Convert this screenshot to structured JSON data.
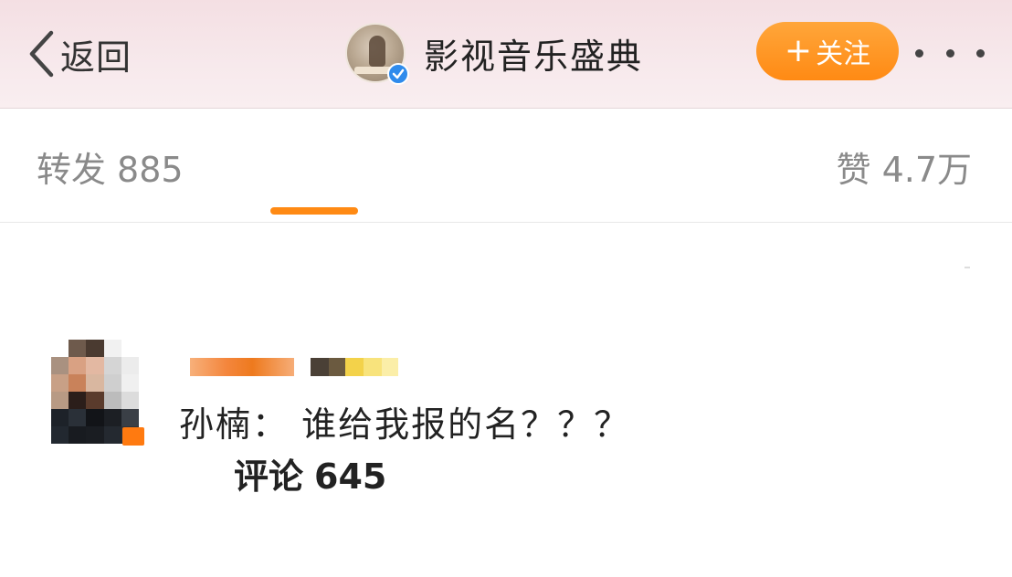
{
  "header": {
    "back_label": "返回",
    "account_name": "影视音乐盛典",
    "follow_label": "关注",
    "verified": true
  },
  "tabs": {
    "repost": {
      "label": "转发",
      "count": "885"
    },
    "comment": {
      "label": "评论",
      "count": "645"
    },
    "like": {
      "label": "赞",
      "count": "4.7万"
    },
    "active": "comment"
  },
  "comment": {
    "text": "孙楠：  谁给我报的名？？？",
    "avatar_blurred": true,
    "username_blurred": true
  },
  "colors": {
    "accent": "#ff8a14",
    "header_bg": "#f4dfe3",
    "verified_blue": "#2f8bec"
  },
  "icons": [
    "chevron-left-icon",
    "verified-icon",
    "plus-icon",
    "more-icon"
  ]
}
